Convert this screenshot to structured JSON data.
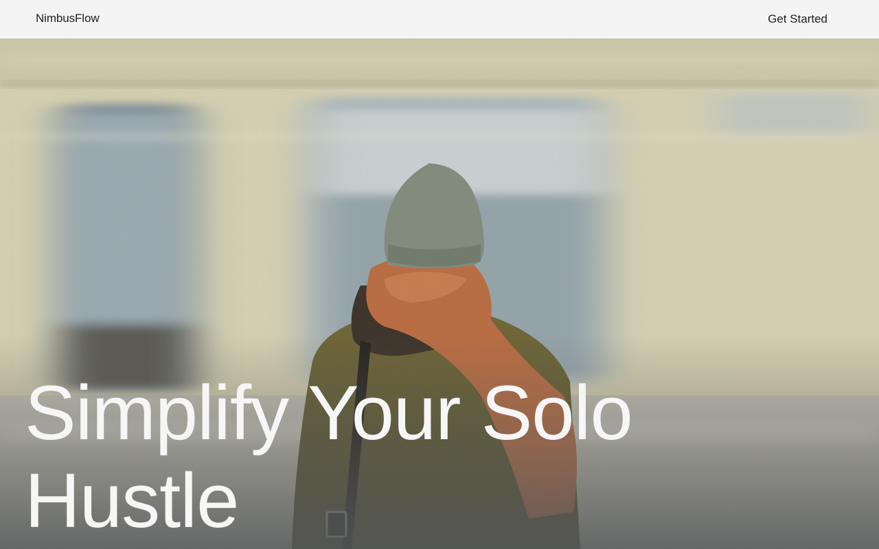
{
  "header": {
    "brand": "NimbusFlow",
    "cta_label": "Get Started"
  },
  "hero": {
    "headline_line1": "Simplify Your Solo",
    "headline_line2": "Hustle",
    "image_alt": "Person in a knit beanie and orange scarf facing a blurred passing subway train"
  },
  "colors": {
    "header_bg": "#f4f4f4",
    "header_text": "#1e1e1e",
    "headline_text": "#f6f6f6"
  }
}
